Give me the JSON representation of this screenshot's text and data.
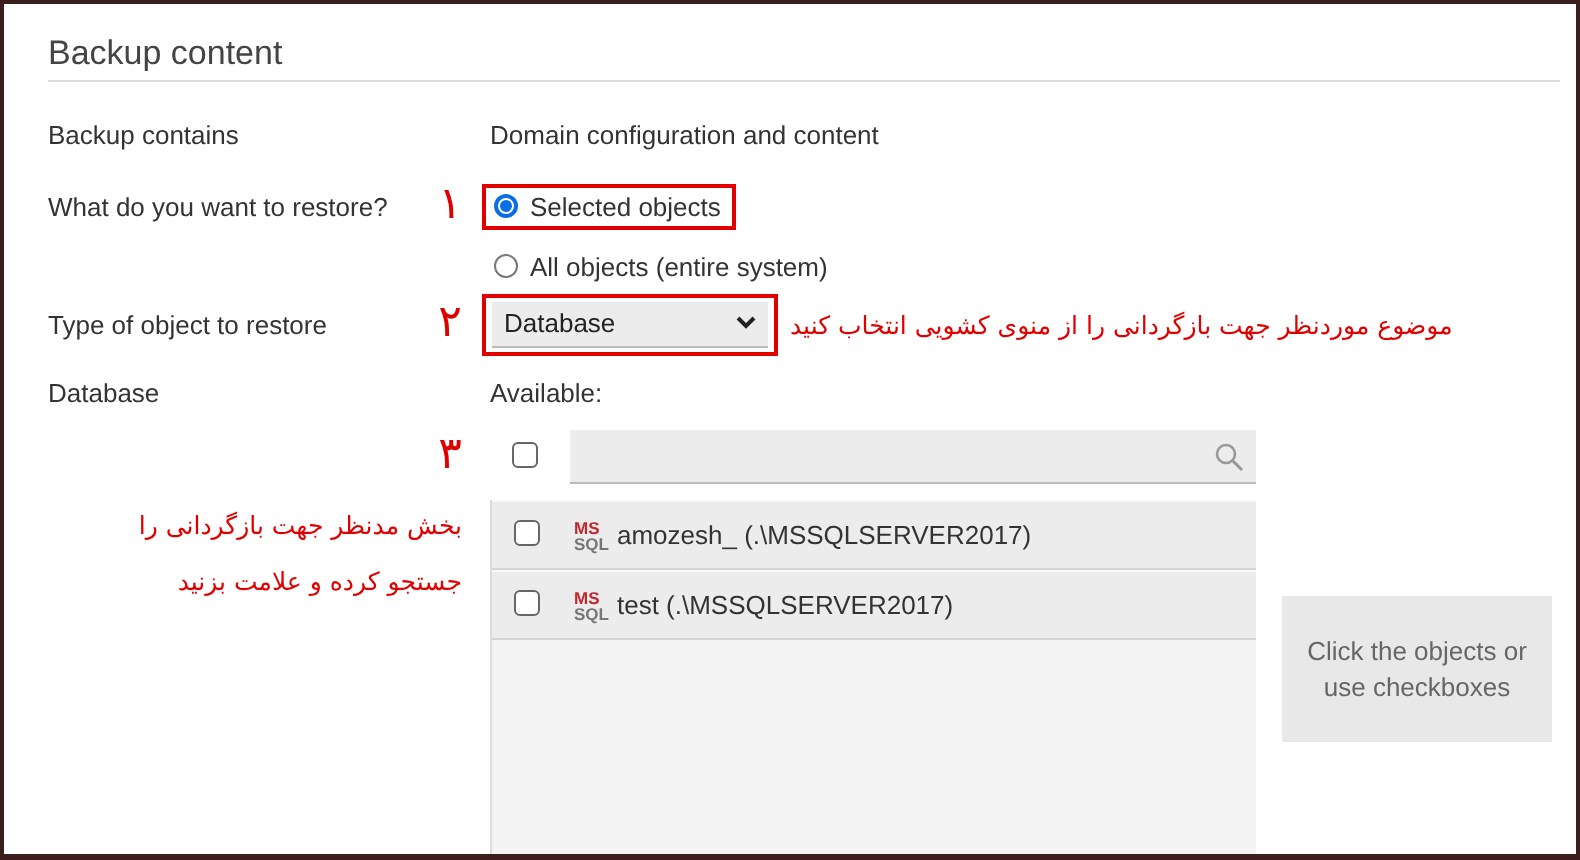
{
  "title": "Backup content",
  "backup_contains": {
    "label": "Backup contains",
    "value": "Domain configuration and content"
  },
  "restore_what": {
    "label": "What do you want to restore?",
    "annotation": "۱",
    "options": [
      {
        "label": "Selected objects",
        "selected": true,
        "highlighted": true
      },
      {
        "label": "All objects (entire system)",
        "selected": false,
        "highlighted": false
      }
    ]
  },
  "object_type": {
    "label": "Type of object to restore",
    "annotation": "۲",
    "value": "Database",
    "highlighted": true,
    "note": "موضوع موردنظر جهت بازگردانی را از منوی کشویی انتخاب کنید"
  },
  "database": {
    "label": "Database",
    "available_label": "Available:",
    "annotation": "۳",
    "note_lines": [
      "بخش مدنظر جهت بازگردانی را",
      "جستجو کرده و علامت بزنید"
    ],
    "select_all_checked": false,
    "items": [
      {
        "badge_top": "MS",
        "badge_bottom": "SQL",
        "name": "amozesh_ (.\\MSSQLSERVER2017)",
        "checked": false
      },
      {
        "badge_top": "MS",
        "badge_bottom": "SQL",
        "name": "test (.\\MSSQLSERVER2017)",
        "checked": false
      }
    ],
    "hint": "Click the objects or use checkboxes"
  }
}
